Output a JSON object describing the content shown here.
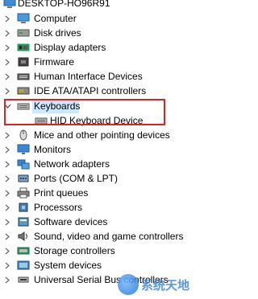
{
  "tree": {
    "root": {
      "label": "DESKTOP-HO96R91",
      "icon": "computer-root-icon"
    },
    "items": [
      {
        "label": "Computer",
        "icon": "computer-icon",
        "expanded": false
      },
      {
        "label": "Disk drives",
        "icon": "disk-drive-icon",
        "expanded": false
      },
      {
        "label": "Display adapters",
        "icon": "display-adapter-icon",
        "expanded": false
      },
      {
        "label": "Firmware",
        "icon": "firmware-icon",
        "expanded": false
      },
      {
        "label": "Human Interface Devices",
        "icon": "hid-icon",
        "expanded": false
      },
      {
        "label": "IDE ATA/ATAPI controllers",
        "icon": "ide-controller-icon",
        "expanded": false
      },
      {
        "label": "Keyboards",
        "icon": "keyboard-icon",
        "expanded": true,
        "selected": true,
        "children": [
          {
            "label": "HID Keyboard Device",
            "icon": "keyboard-icon"
          }
        ]
      },
      {
        "label": "Mice and other pointing devices",
        "icon": "mouse-icon",
        "expanded": false
      },
      {
        "label": "Monitors",
        "icon": "monitor-icon",
        "expanded": false
      },
      {
        "label": "Network adapters",
        "icon": "network-adapter-icon",
        "expanded": false
      },
      {
        "label": "Ports (COM & LPT)",
        "icon": "port-icon",
        "expanded": false
      },
      {
        "label": "Print queues",
        "icon": "printer-icon",
        "expanded": false
      },
      {
        "label": "Processors",
        "icon": "processor-icon",
        "expanded": false
      },
      {
        "label": "Software devices",
        "icon": "software-device-icon",
        "expanded": false
      },
      {
        "label": "Sound, video and game controllers",
        "icon": "sound-icon",
        "expanded": false
      },
      {
        "label": "Storage controllers",
        "icon": "storage-controller-icon",
        "expanded": false
      },
      {
        "label": "System devices",
        "icon": "system-device-icon",
        "expanded": false
      },
      {
        "label": "Universal Serial Bus controllers",
        "icon": "usb-icon",
        "expanded": false
      }
    ]
  },
  "watermark": {
    "text": "系统天地"
  },
  "colors": {
    "selection": "#cce8ff",
    "callout_border": "#e02020",
    "chevron": "#555555"
  }
}
